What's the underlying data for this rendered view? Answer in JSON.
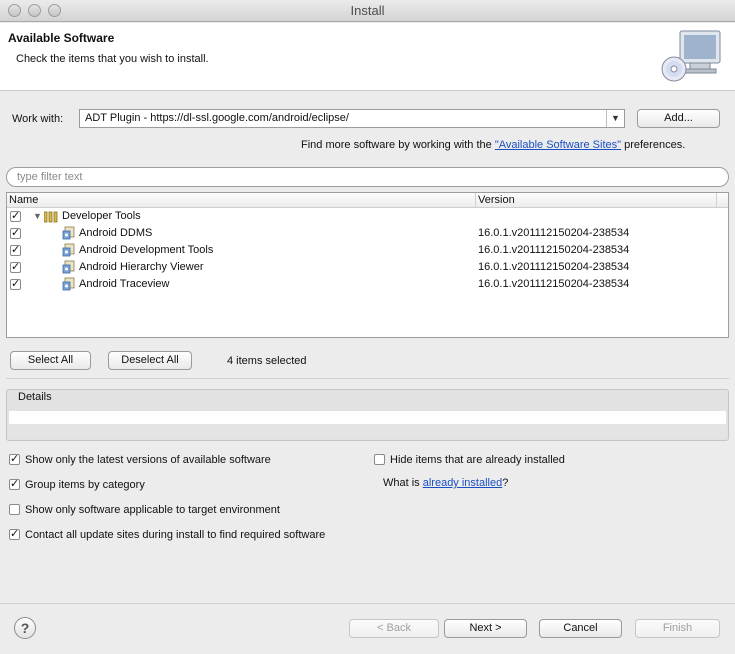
{
  "window": {
    "title": "Install"
  },
  "banner": {
    "title": "Available Software",
    "subtitle": "Check the items that you wish to install.",
    "icon": "monitor-cd-icon"
  },
  "work_with": {
    "label": "Work with:",
    "value": "ADT Plugin - https://dl-ssl.google.com/android/eclipse/",
    "add_button": "Add...",
    "find_more_prefix": "Find more software by working with the ",
    "find_more_link": "\"Available Software Sites\"",
    "find_more_suffix": " preferences."
  },
  "filter": {
    "placeholder": "type filter text"
  },
  "tree": {
    "columns": [
      "Name",
      "Version"
    ],
    "group": {
      "label": "Developer Tools",
      "checked": true,
      "expanded": true
    },
    "items": [
      {
        "name": "Android DDMS",
        "version": "16.0.1.v201112150204-238534",
        "checked": true
      },
      {
        "name": "Android Development Tools",
        "version": "16.0.1.v201112150204-238534",
        "checked": true
      },
      {
        "name": "Android Hierarchy Viewer",
        "version": "16.0.1.v201112150204-238534",
        "checked": true
      },
      {
        "name": "Android Traceview",
        "version": "16.0.1.v201112150204-238534",
        "checked": true
      }
    ]
  },
  "selection": {
    "select_all": "Select All",
    "deselect_all": "Deselect All",
    "status": "4 items selected"
  },
  "details": {
    "label": "Details"
  },
  "options": {
    "latest_versions": {
      "label": "Show only the latest versions of available software",
      "checked": true
    },
    "group_by_category": {
      "label": "Group items by category",
      "checked": true
    },
    "applicable_only": {
      "label": "Show only software applicable to target environment",
      "checked": false
    },
    "contact_update_sites": {
      "label": "Contact all update sites during install to find required software",
      "checked": true
    },
    "hide_installed": {
      "label": "Hide items that are already installed",
      "checked": false
    },
    "what_is_prefix": "What is ",
    "what_is_link": "already installed",
    "what_is_suffix": "?"
  },
  "footer": {
    "help": "?",
    "back": "< Back",
    "next": "Next >",
    "cancel": "Cancel",
    "finish": "Finish"
  }
}
